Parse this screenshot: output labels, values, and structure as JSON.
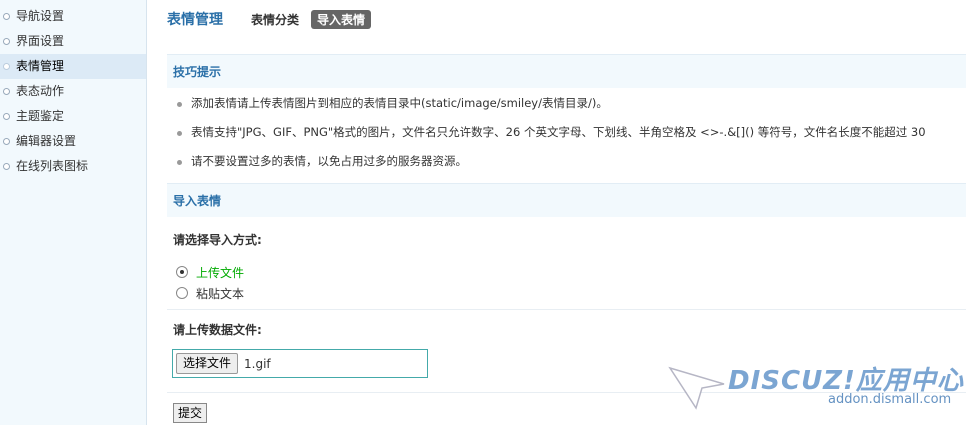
{
  "sidebar": {
    "items": [
      {
        "label": "导航设置",
        "active": false
      },
      {
        "label": "界面设置",
        "active": false
      },
      {
        "label": "表情管理",
        "active": true
      },
      {
        "label": "表态动作",
        "active": false
      },
      {
        "label": "主题鉴定",
        "active": false
      },
      {
        "label": "编辑器设置",
        "active": false
      },
      {
        "label": "在线列表图标",
        "active": false
      }
    ]
  },
  "header": {
    "title": "表情管理",
    "tabs": [
      {
        "label": "表情分类",
        "active": false
      },
      {
        "label": "导入表情",
        "active": true
      }
    ]
  },
  "tips": {
    "title": "技巧提示",
    "items": [
      "添加表情请上传表情图片到相应的表情目录中(static/image/smiley/表情目录/)。",
      "表情支持\"JPG、GIF、PNG\"格式的图片，文件名只允许数字、26 个英文字母、下划线、半角空格及 <>-.&[]() 等符号，文件名长度不能超过 30",
      "请不要设置过多的表情，以免占用过多的服务器资源。"
    ]
  },
  "import": {
    "title": "导入表情",
    "method_label": "请选择导入方式:",
    "options": [
      {
        "label": "上传文件",
        "checked": true
      },
      {
        "label": "粘贴文本",
        "checked": false
      }
    ],
    "file_label": "请上传数据文件:",
    "file_button": "选择文件",
    "file_name": "1.gif",
    "submit": "提交"
  },
  "watermark": {
    "logo_text": "DISCUZ!应用中心",
    "url": "addon.dismall.com"
  }
}
